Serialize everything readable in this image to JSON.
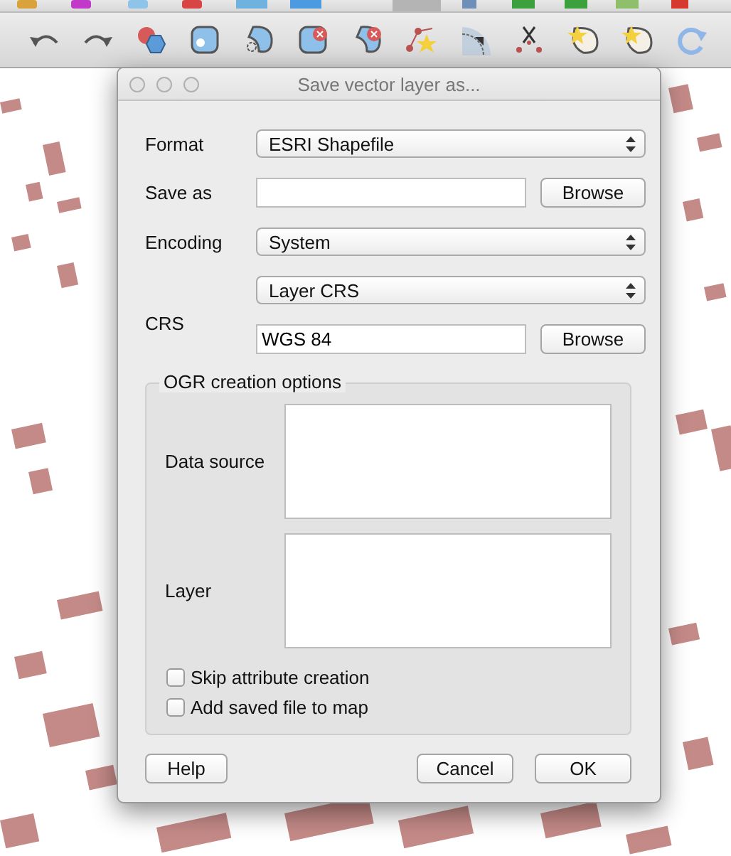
{
  "dialog": {
    "title": "Save vector layer as...",
    "format": {
      "label": "Format",
      "value": "ESRI Shapefile"
    },
    "save_as": {
      "label": "Save as",
      "button": "Browse"
    },
    "encoding": {
      "label": "Encoding",
      "value": "System"
    },
    "crs": {
      "label": "CRS",
      "mode": "Layer CRS",
      "value": "WGS 84",
      "button": "Browse"
    },
    "ogr_options": {
      "title": "OGR creation options",
      "fields": [
        {
          "label": "Data source"
        },
        {
          "label": "Layer"
        }
      ]
    },
    "checkboxes": [
      {
        "label": "Skip attribute creation",
        "checked": false
      },
      {
        "label": "Add saved file to map",
        "checked": false
      }
    ],
    "buttons": {
      "help": "Help",
      "cancel": "Cancel",
      "ok": "OK"
    }
  }
}
